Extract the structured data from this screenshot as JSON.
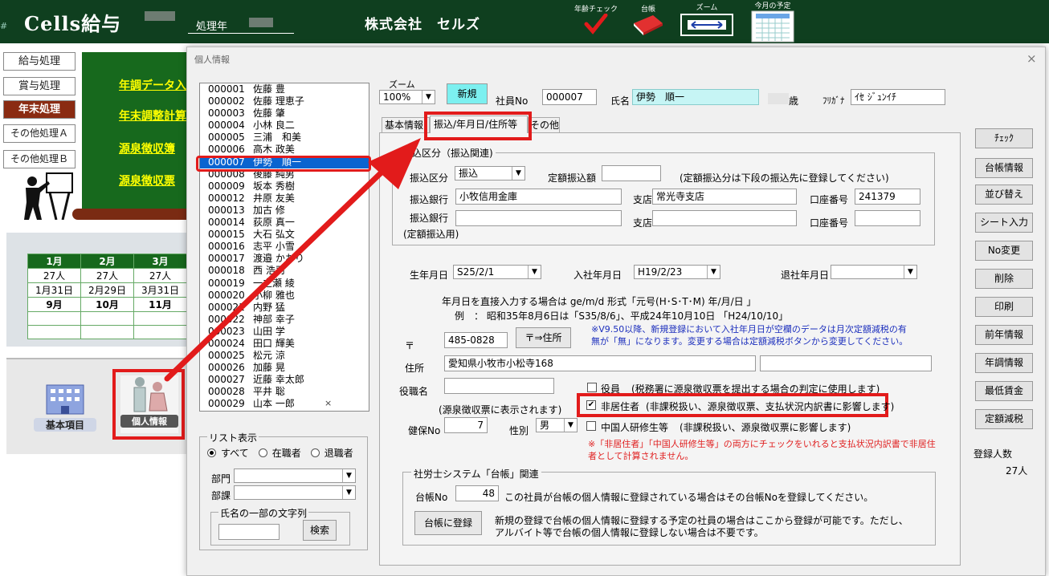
{
  "app": {
    "title": "Cells給与",
    "hash": "#",
    "year_label": "処理年",
    "company": "株式会社　セルズ"
  },
  "toolbar": {
    "age_check": "年齢チェック",
    "ledger": "台帳",
    "zoom": "ズーム",
    "monthly_plan": "今月の予定"
  },
  "menu": [
    "給与処理",
    "賞与処理",
    "年末処理",
    "その他処理Ａ",
    "その他処理Ｂ"
  ],
  "green_links": [
    "年調データ入",
    "年末調整計算",
    "源泉徴収簿",
    "源泉徴収票"
  ],
  "calendar": {
    "months": [
      "1月",
      "2月",
      "3月"
    ],
    "counts": [
      "27人",
      "27人",
      "27人"
    ],
    "dates": [
      "1月31日",
      "2月29日",
      "3月31日"
    ],
    "next": [
      "9月",
      "10月",
      "11月"
    ]
  },
  "bottom_icons": {
    "basic": "基本項目",
    "personal": "個人情報"
  },
  "dialog": {
    "title": "個人情報",
    "close": "×"
  },
  "employees": [
    {
      "no": "000001",
      "name": "佐藤 豊"
    },
    {
      "no": "000002",
      "name": "佐藤 理恵子"
    },
    {
      "no": "000003",
      "name": "佐藤 肇"
    },
    {
      "no": "000004",
      "name": "小林 良二"
    },
    {
      "no": "000005",
      "name": "三浦　和美"
    },
    {
      "no": "000006",
      "name": "高木 政美"
    },
    {
      "no": "000007",
      "name": "伊勢　順一"
    },
    {
      "no": "000008",
      "name": "後藤 純男"
    },
    {
      "no": "000009",
      "name": "坂本 秀樹"
    },
    {
      "no": "000012",
      "name": "井原 友美"
    },
    {
      "no": "000013",
      "name": "加古 修"
    },
    {
      "no": "000014",
      "name": "荻原 真一"
    },
    {
      "no": "000015",
      "name": "大石 弘文"
    },
    {
      "no": "000016",
      "name": "志平 小雪"
    },
    {
      "no": "000017",
      "name": "渡邉 かおり"
    },
    {
      "no": "000018",
      "name": "西 浩司"
    },
    {
      "no": "000019",
      "name": "一之瀬 綾"
    },
    {
      "no": "000020",
      "name": "小柳 雅也"
    },
    {
      "no": "000021",
      "name": "内野 猛"
    },
    {
      "no": "000022",
      "name": "神部 幸子"
    },
    {
      "no": "000023",
      "name": "山田 学"
    },
    {
      "no": "000024",
      "name": "田口 輝美"
    },
    {
      "no": "000025",
      "name": "松元 涼"
    },
    {
      "no": "000026",
      "name": "加藤 晃"
    },
    {
      "no": "000027",
      "name": "近藤 幸太郎"
    },
    {
      "no": "000028",
      "name": "平井 聡"
    },
    {
      "no": "000029",
      "name": "山本 一郎"
    }
  ],
  "list_filter": {
    "title": "リスト表示",
    "radios": [
      "すべて",
      "在職者",
      "退職者"
    ],
    "dept_label": "部門",
    "section_label": "部課",
    "name_search_title": "氏名の一部の文字列",
    "search_button": "検索"
  },
  "header": {
    "zoom_label": "ズーム",
    "zoom_value": "100%",
    "new_button": "新規",
    "emp_no_label": "社員No",
    "emp_no": "000007",
    "name_label": "氏名",
    "name": "伊勢　順一",
    "age_unit": "歳",
    "furigana_label": "ﾌﾘｶﾞﾅ",
    "furigana": "ｲｾ ｼﾞｭﾝｲﾁ"
  },
  "tabs": [
    "基本情報",
    "振込/年月日/住所等",
    "その他"
  ],
  "transfer": {
    "group_title": "振込区分（振込関連)",
    "type_label": "振込区分",
    "type_value": "振込",
    "fixed_label": "定額振込額",
    "fixed_note": "(定額振込分は下段の振込先に登録してください)",
    "bank_label": "振込銀行",
    "bank": "小牧信用金庫",
    "branch_label": "支店",
    "branch": "常光寺支店",
    "account_label": "口座番号",
    "account": "241379",
    "bank2_label": "振込銀行",
    "bank2_sub": "(定額振込用)",
    "branch2_label": "支店",
    "account2_label": "口座番号"
  },
  "dates": {
    "birth_label": "生年月日",
    "birth": "S25/2/1",
    "join_label": "入社年月日",
    "join": "H19/2/23",
    "leave_label": "退社年月日",
    "hint1": "年月日を直接入力する場合は ge/m/d  形式「元号(H･S･T･M)  年/月/日 」",
    "hint2": "例　：  昭和35年8月6日は「S35/8/6」、平成24年10月10日 「H24/10/10」"
  },
  "address": {
    "zip_label": "〒",
    "zip": "485-0828",
    "zip_button": "〒⇒住所",
    "note": "※V9.50以降、新規登録において入社年月日が空欄のデータは月次定額減税の有無が「無」になります。変更する場合は定額減税ボタンから変更してください。",
    "addr_label": "住所",
    "addr": "愛知県小牧市小松寺168"
  },
  "misc": {
    "title_label": "役職名",
    "title_sub": "(源泉徴収票に表示されます)",
    "officer_label": "役員",
    "officer_note": "(税務署に源泉徴収票を提出する場合の判定に使用します)",
    "nonresident_label": "非居住者",
    "nonresident_note": "(非課税扱い、源泉徴収票、支払状況内訳書に影響します)",
    "insurance_label": "健保No",
    "insurance": "7",
    "gender_label": "性別",
    "gender": "男",
    "trainee_label": "中国人研修生等",
    "trainee_note": "(非課税扱い、源泉徴収票に影響します)",
    "red_note": "※「非居住者」「中国人研修生等」の両方にチェックをいれると支払状況内訳書で非居住者として計算されません。"
  },
  "ledger": {
    "group_title": "社労士システム「台帳」関連",
    "no_label": "台帳No",
    "no": "48",
    "no_note": "この社員が台帳の個人情報に登録されている場合はその台帳Noを登録してください。",
    "register_button": "台帳に登録",
    "register_note1": "新規の登録で台帳の個人情報に登録する予定の社員の場合はここから登録が可能です。ただし、",
    "register_note2": "アルバイト等で台帳の個人情報に登録しない場合は不要です。"
  },
  "side_buttons": [
    "ﾁｪｯｸ",
    "台帳情報",
    "並び替え",
    "シート入力",
    "No変更",
    "削除",
    "印刷",
    "前年情報",
    "年調情報",
    "最低賃金",
    "定額減税"
  ],
  "count": {
    "label": "登録人数",
    "value": "27人"
  },
  "colors": {
    "topbar": "#0f3f1f",
    "green": "#17691d",
    "highlight": "#e21b1b",
    "selection": "#0a64d0",
    "name_field": "#c6f5f5"
  },
  "checks": {
    "officer": false,
    "nonresident": true,
    "trainee": false
  },
  "list_filter_selected": "すべて"
}
